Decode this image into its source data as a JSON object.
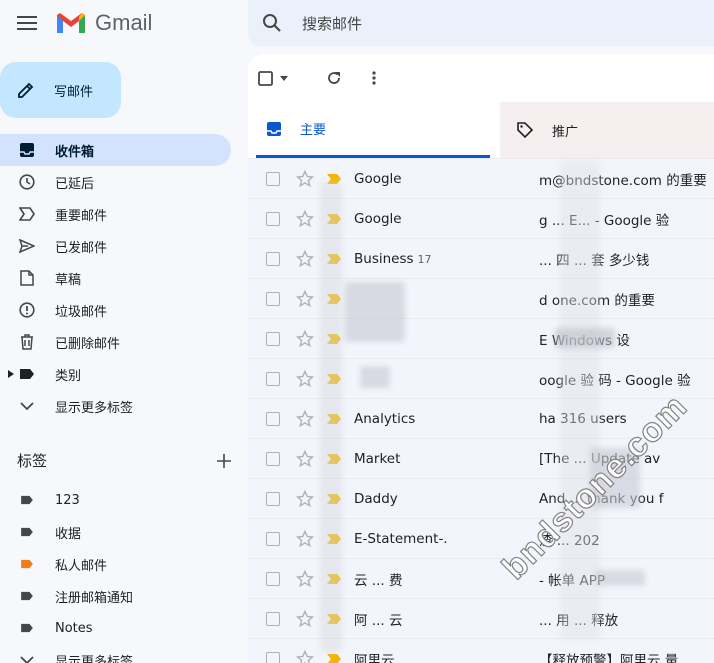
{
  "app": {
    "name": "Gmail"
  },
  "search": {
    "placeholder": "搜索邮件"
  },
  "compose": {
    "label": "写邮件"
  },
  "nav": [
    {
      "label": "收件箱",
      "icon": "inbox-icon"
    },
    {
      "label": "已延后",
      "icon": "clock-icon"
    },
    {
      "label": "重要邮件",
      "icon": "important-icon"
    },
    {
      "label": "已发邮件",
      "icon": "send-icon"
    },
    {
      "label": "草稿",
      "icon": "draft-icon"
    },
    {
      "label": "垃圾邮件",
      "icon": "spam-icon"
    },
    {
      "label": "已删除邮件",
      "icon": "trash-icon"
    },
    {
      "label": "类别",
      "icon": "label-icon"
    },
    {
      "label": "显示更多标签",
      "icon": "chevron-down-icon"
    }
  ],
  "labels": {
    "title": "标签",
    "items": [
      {
        "label": "123",
        "color": "#444746"
      },
      {
        "label": "收据",
        "color": "#444746"
      },
      {
        "label": "私人邮件",
        "color": "#f07d18"
      },
      {
        "label": "注册邮箱通知",
        "color": "#444746"
      },
      {
        "label": "Notes",
        "color": "#444746"
      },
      {
        "label": "显示更多标签",
        "color": "#444746"
      }
    ]
  },
  "tabs": [
    {
      "label": "主要"
    },
    {
      "label": "推广"
    }
  ],
  "emails": [
    {
      "sender": "Google",
      "count": "",
      "snippet": "m@bndstone.com 的重要"
    },
    {
      "sender": "Google",
      "count": "",
      "snippet": "g ... E... - Google 验"
    },
    {
      "sender": "Business",
      "count": "17",
      "snippet": "... 四 ... 套 多少钱"
    },
    {
      "sender": "",
      "count": "",
      "snippet": "d one.com 的重要"
    },
    {
      "sender": "",
      "count": "",
      "snippet": "E Windows 设"
    },
    {
      "sender": "",
      "count": "",
      "snippet": "oogle 验 码 - Google 验"
    },
    {
      "sender": "Analytics",
      "count": "",
      "snippet": "ha 316 users"
    },
    {
      "sender": "Market",
      "count": "",
      "snippet": "[The ... Update av"
    },
    {
      "sender": "Daddy",
      "count": "",
      "snippet": "And ... thank you f"
    },
    {
      "sender": "E-Statement-.",
      "count": "",
      "snippet": "渣 ... 202"
    },
    {
      "sender": "云 ... 费",
      "count": "",
      "snippet": "- 帐单 APP"
    },
    {
      "sender": "阿 ... 云",
      "count": "",
      "snippet": "... 用 ... 释放"
    },
    {
      "sender": "阿里云",
      "count": "",
      "snippet": "【释放预警】阿里云 量"
    }
  ],
  "watermark": "bndstone.com",
  "colors": {
    "accent": "#0b57d0",
    "compose_bg": "#c2e7ff",
    "active_nav": "#d3e3fd",
    "important": "#f4b400"
  }
}
